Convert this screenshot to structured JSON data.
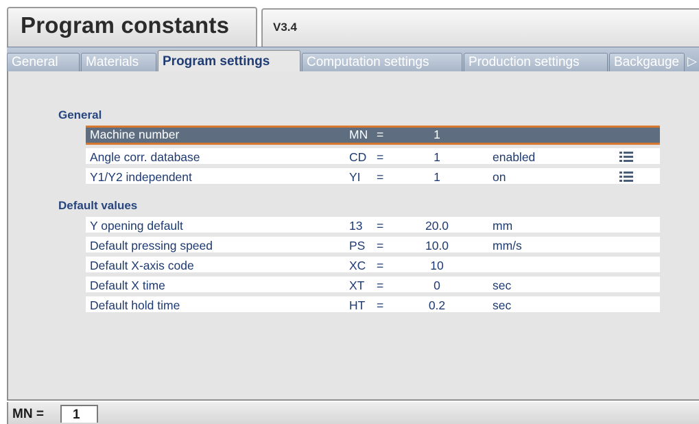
{
  "header": {
    "title": "Program constants",
    "version": "V3.4"
  },
  "tabs": [
    {
      "label": "General",
      "active": false
    },
    {
      "label": "Materials",
      "active": false
    },
    {
      "label": "Program settings",
      "active": true
    },
    {
      "label": "Computation settings",
      "active": false
    },
    {
      "label": "Production settings",
      "active": false
    },
    {
      "label": "Backgauge",
      "active": false
    }
  ],
  "tab_scroll_icon": "triangle-right-icon",
  "sections": [
    {
      "title": "General",
      "rows": [
        {
          "label": "Machine number",
          "code": "MN",
          "eq": "=",
          "value": "1",
          "unit": "",
          "list_icon": false,
          "selected": true
        },
        {
          "label": "Angle corr. database",
          "code": "CD",
          "eq": "=",
          "value": "1",
          "unit": "enabled",
          "list_icon": true,
          "selected": false
        },
        {
          "label": "Y1/Y2 independent",
          "code": "YI",
          "eq": "=",
          "value": "1",
          "unit": "on",
          "list_icon": true,
          "selected": false
        }
      ]
    },
    {
      "title": "Default values",
      "rows": [
        {
          "label": "Y opening default",
          "code": "13",
          "eq": "=",
          "value": "20.0",
          "unit": "mm",
          "list_icon": false,
          "selected": false
        },
        {
          "label": "Default pressing speed",
          "code": "PS",
          "eq": "=",
          "value": "10.0",
          "unit": "mm/s",
          "list_icon": false,
          "selected": false
        },
        {
          "label": "Default X-axis code",
          "code": "XC",
          "eq": "=",
          "value": "10",
          "unit": "",
          "list_icon": false,
          "selected": false
        },
        {
          "label": "Default X time",
          "code": "XT",
          "eq": "=",
          "value": "0",
          "unit": "sec",
          "list_icon": false,
          "selected": false
        },
        {
          "label": "Default hold time",
          "code": "HT",
          "eq": "=",
          "value": "0.2",
          "unit": "sec",
          "list_icon": false,
          "selected": false
        }
      ]
    }
  ],
  "status": {
    "code": "MN =",
    "value": "1"
  },
  "colors": {
    "selection_bg": "#5e6e80",
    "selection_border": "#d9772e",
    "section_title": "#27457f",
    "tab_bar": "#a7b5c8"
  }
}
